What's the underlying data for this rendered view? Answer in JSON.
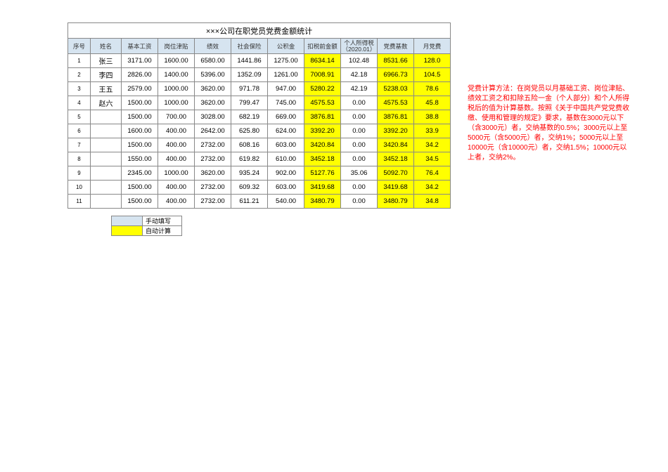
{
  "title": "×××公司在职党员党费金额统计",
  "headers": [
    "序号",
    "姓名",
    "基本工资",
    "岗位津贴",
    "绩效",
    "社会保险",
    "公积金",
    "扣税前金额",
    "个人所得税（2020.01）",
    "党费基数",
    "月党费"
  ],
  "rows": [
    {
      "seq": "1",
      "name": "张三",
      "base": "3171.00",
      "allow": "1600.00",
      "perf": "6580.00",
      "social": "1441.86",
      "fund": "1275.00",
      "pretax": "8634.14",
      "tax": "102.48",
      "jishu": "8531.66",
      "fee": "128.0"
    },
    {
      "seq": "2",
      "name": "李四",
      "base": "2826.00",
      "allow": "1400.00",
      "perf": "5396.00",
      "social": "1352.09",
      "fund": "1261.00",
      "pretax": "7008.91",
      "tax": "42.18",
      "jishu": "6966.73",
      "fee": "104.5"
    },
    {
      "seq": "3",
      "name": "王五",
      "base": "2579.00",
      "allow": "1000.00",
      "perf": "3620.00",
      "social": "971.78",
      "fund": "947.00",
      "pretax": "5280.22",
      "tax": "42.19",
      "jishu": "5238.03",
      "fee": "78.6"
    },
    {
      "seq": "4",
      "name": "赵六",
      "base": "1500.00",
      "allow": "1000.00",
      "perf": "3620.00",
      "social": "799.47",
      "fund": "745.00",
      "pretax": "4575.53",
      "tax": "0.00",
      "jishu": "4575.53",
      "fee": "45.8"
    },
    {
      "seq": "5",
      "name": "",
      "base": "1500.00",
      "allow": "700.00",
      "perf": "3028.00",
      "social": "682.19",
      "fund": "669.00",
      "pretax": "3876.81",
      "tax": "0.00",
      "jishu": "3876.81",
      "fee": "38.8"
    },
    {
      "seq": "6",
      "name": "",
      "base": "1600.00",
      "allow": "400.00",
      "perf": "2642.00",
      "social": "625.80",
      "fund": "624.00",
      "pretax": "3392.20",
      "tax": "0.00",
      "jishu": "3392.20",
      "fee": "33.9"
    },
    {
      "seq": "7",
      "name": "",
      "base": "1500.00",
      "allow": "400.00",
      "perf": "2732.00",
      "social": "608.16",
      "fund": "603.00",
      "pretax": "3420.84",
      "tax": "0.00",
      "jishu": "3420.84",
      "fee": "34.2"
    },
    {
      "seq": "8",
      "name": "",
      "base": "1550.00",
      "allow": "400.00",
      "perf": "2732.00",
      "social": "619.82",
      "fund": "610.00",
      "pretax": "3452.18",
      "tax": "0.00",
      "jishu": "3452.18",
      "fee": "34.5"
    },
    {
      "seq": "9",
      "name": "",
      "base": "2345.00",
      "allow": "1000.00",
      "perf": "3620.00",
      "social": "935.24",
      "fund": "902.00",
      "pretax": "5127.76",
      "tax": "35.06",
      "jishu": "5092.70",
      "fee": "76.4"
    },
    {
      "seq": "10",
      "name": "",
      "base": "1500.00",
      "allow": "400.00",
      "perf": "2732.00",
      "social": "609.32",
      "fund": "603.00",
      "pretax": "3419.68",
      "tax": "0.00",
      "jishu": "3419.68",
      "fee": "34.2"
    },
    {
      "seq": "11",
      "name": "",
      "base": "1500.00",
      "allow": "400.00",
      "perf": "2732.00",
      "social": "611.21",
      "fund": "540.00",
      "pretax": "3480.79",
      "tax": "0.00",
      "jishu": "3480.79",
      "fee": "34.8"
    }
  ],
  "legend": {
    "manual": "手动填写",
    "auto": "自动计算"
  },
  "sidenote": "党费计算方法：在岗党员以月基础工资、岗位津贴、绩效工资之和扣除五险一金（个人部分）和个人所得税后的值为计算基数。按照《关于中国共产党党费收缴、使用和管理的规定》要求，基数在3000元以下（含3000元）者，交纳基数的0.5%；3000元以上至5000元（含5000元）者，交纳1%；5000元以上至10000元（含10000元）者，交纳1.5%；10000元以上者，交纳2%。"
}
